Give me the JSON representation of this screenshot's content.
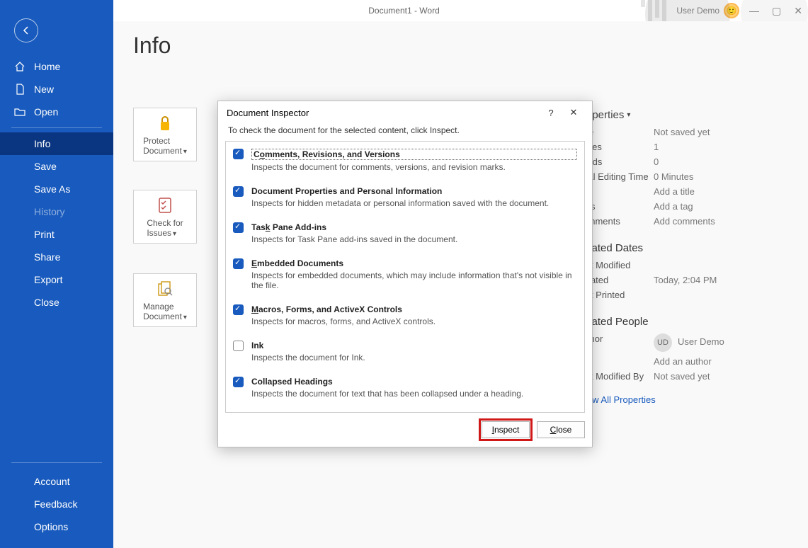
{
  "titlebar": {
    "title": "Document1  -  Word",
    "user": "User Demo"
  },
  "sidebar": {
    "top": [
      {
        "label": "Home"
      },
      {
        "label": "New"
      },
      {
        "label": "Open"
      }
    ],
    "mid": [
      {
        "label": "Info",
        "selected": true
      },
      {
        "label": "Save"
      },
      {
        "label": "Save As"
      },
      {
        "label": "History",
        "disabled": true
      },
      {
        "label": "Print"
      },
      {
        "label": "Share"
      },
      {
        "label": "Export"
      },
      {
        "label": "Close"
      }
    ],
    "bottom": [
      {
        "label": "Account"
      },
      {
        "label": "Feedback"
      },
      {
        "label": "Options"
      }
    ]
  },
  "main": {
    "heading": "Info",
    "cards": {
      "protect": {
        "line1": "Protect",
        "line2": "Document"
      },
      "check": {
        "line1": "Check for",
        "line2": "Issues"
      },
      "manage": {
        "line1": "Manage",
        "line2": "Document"
      }
    }
  },
  "props": {
    "heading": "Properties",
    "rows1": [
      {
        "k": "Size",
        "v": "Not saved yet"
      },
      {
        "k": "Pages",
        "v": "1"
      },
      {
        "k": "Words",
        "v": "0"
      },
      {
        "k": "Total Editing Time",
        "v": "0 Minutes"
      },
      {
        "k": "Title",
        "v": "Add a title"
      },
      {
        "k": "Tags",
        "v": "Add a tag"
      },
      {
        "k": "Comments",
        "v": "Add comments"
      }
    ],
    "section_dates": "Related Dates",
    "dates": [
      {
        "k": "Last Modified",
        "v": ""
      },
      {
        "k": "Created",
        "v": "Today, 2:04 PM"
      },
      {
        "k": "Last Printed",
        "v": ""
      }
    ],
    "section_people": "Related People",
    "people_author_label": "Author",
    "people_user_initials": "UD",
    "people_user_name": "User Demo",
    "add_author": "Add an author",
    "last_modified_by": "Last Modified By",
    "last_modified_by_v": "Not saved yet",
    "show_all": "Show All Properties"
  },
  "dialog": {
    "title": "Document Inspector",
    "subtitle": "To check the document for the selected content, click Inspect.",
    "items": [
      {
        "checked": true,
        "title_pre": "C",
        "title_u": "o",
        "title_post": "mments, Revisions, and Versions",
        "desc": "Inspects the document for comments, versions, and revision marks."
      },
      {
        "checked": true,
        "title_pre": "Document Properties and Personal Information",
        "title_u": "",
        "title_post": "",
        "desc": "Inspects for hidden metadata or personal information saved with the document."
      },
      {
        "checked": true,
        "title_pre": "Tas",
        "title_u": "k",
        "title_post": " Pane Add-ins",
        "desc": "Inspects for Task Pane add-ins saved in the document."
      },
      {
        "checked": true,
        "title_pre": "",
        "title_u": "E",
        "title_post": "mbedded Documents",
        "desc": "Inspects for embedded documents, which may include information that's not visible in the file."
      },
      {
        "checked": true,
        "title_pre": "",
        "title_u": "M",
        "title_post": "acros, Forms, and ActiveX Controls",
        "desc": "Inspects for macros, forms, and ActiveX controls."
      },
      {
        "checked": false,
        "title_pre": "Ink",
        "title_u": "",
        "title_post": "",
        "desc": "Inspects the document for Ink."
      },
      {
        "checked": true,
        "title_pre": "Collapsed Headings",
        "title_u": "",
        "title_post": "",
        "desc": "Inspects the document for text that has been collapsed under a heading."
      }
    ],
    "inspect_btn_pre": "",
    "inspect_btn_u": "I",
    "inspect_btn_post": "nspect",
    "close_btn_pre": "",
    "close_btn_u": "C",
    "close_btn_post": "lose"
  }
}
